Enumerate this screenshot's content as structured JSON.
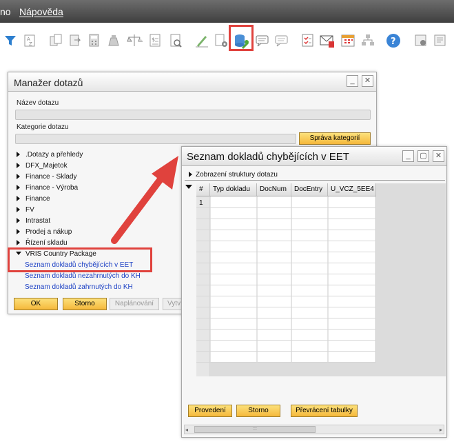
{
  "menubar": {
    "item1": "no",
    "item2": "Nápověda"
  },
  "toolbar": {
    "icons": [
      "filter-icon",
      "sort-icon",
      "copy-icon",
      "paste-icon",
      "calculator-icon",
      "money-bag-icon",
      "balance-icon",
      "form-icon",
      "search-document-icon",
      "sign-icon",
      "document-settings-icon",
      "query-manager-icon",
      "chat-icon",
      "chat-forward-icon",
      "tasks-icon",
      "email-icon",
      "calendar-icon",
      "hierarchy-icon",
      "help-icon",
      "settings-icon",
      "print-icon"
    ]
  },
  "manager": {
    "title": "Manažer dotazů",
    "name_label": "Název dotazu",
    "category_label": "Kategorie dotazu",
    "manage_categories": "Správa kategorií",
    "tree": [
      {
        "label": ".Dotazy a přehledy"
      },
      {
        "label": "DFX_Majetok"
      },
      {
        "label": "Finance - Sklady"
      },
      {
        "label": "Finance - Výroba"
      },
      {
        "label": "Finance"
      },
      {
        "label": "FV"
      },
      {
        "label": "Intrastat"
      },
      {
        "label": "Prodej a nákup"
      },
      {
        "label": "Řízení skladu"
      }
    ],
    "expanded": "VRIS Country Package",
    "queries": [
      "Seznam dokladů chybějících v EET",
      "Seznam dokladů nezahrnutých do KH",
      "Seznam dokladů zahrnutých do KH"
    ],
    "ok": "OK",
    "cancel": "Storno",
    "schedule": "Naplánování",
    "create": "Vytv"
  },
  "result": {
    "title": "Seznam dokladů chybějících v EET",
    "structure": "Zobrazení struktury dotazu",
    "columns": [
      "#",
      "Typ dokladu",
      "DocNum",
      "DocEntry",
      "U_VCZ_5EE4"
    ],
    "row1": "1",
    "execute": "Provedení",
    "cancel": "Storno",
    "transpose": "Převrácení tabulky",
    "scroll_grip": ":::"
  },
  "colors": {
    "highlight": "#e0423d",
    "link": "#1a3fc4",
    "button": "#f5b83b"
  }
}
